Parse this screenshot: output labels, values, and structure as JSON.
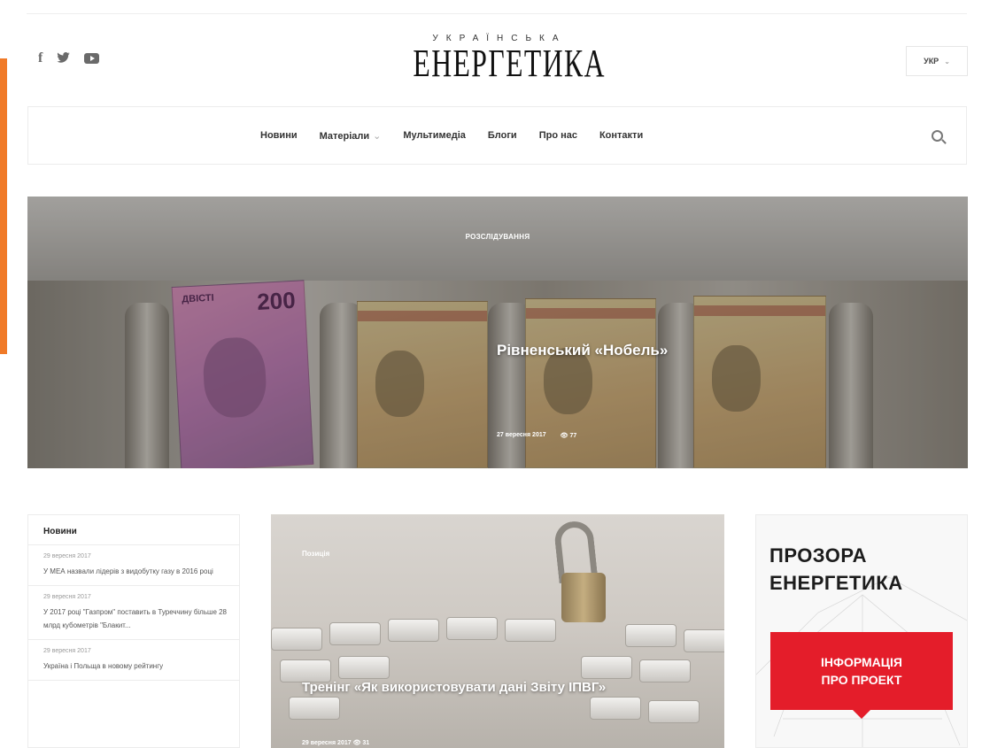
{
  "social": {
    "facebook": "f",
    "icons": [
      "facebook-icon",
      "twitter-icon",
      "youtube-icon"
    ]
  },
  "logo": {
    "small": "УКРАЇНСЬКА",
    "main": "ЕНЕРГЕТИКА"
  },
  "language": {
    "selected": "УКР",
    "chevron": "⌄"
  },
  "nav": {
    "items": [
      "Новини",
      "Матеріали",
      "Мультимедіа",
      "Блоги",
      "Про нас",
      "Контакти"
    ],
    "dropdown_marker": "⌄"
  },
  "hero": {
    "category": "РОЗСЛІДУВАННЯ",
    "title": "Рівненський «Нобель»",
    "date": "27 вересня 2017",
    "views": "👁 77",
    "banknote_label": "ДВІСТІ",
    "banknote_value": "200"
  },
  "news": {
    "title": "Новини",
    "items": [
      {
        "date": "29 вересня 2017",
        "text": "У МЕА назвали лідерів з видобутку газу в 2016 році"
      },
      {
        "date": "29 вересня 2017",
        "text": "У 2017 році \"Газпром\" поставить в Туреччину більше 28 млрд кубометрів \"Блакит..."
      },
      {
        "date": "29 вересня 2017",
        "text": "Україна і Польща в новому рейтингу"
      }
    ]
  },
  "featured": {
    "category": "Позиція",
    "title": "Тренінг «Як використовувати дані Звіту ІПВГ»",
    "meta": "29 вересня 2017   👁 31"
  },
  "promo": {
    "line1": "ПРОЗОРА",
    "line2": "ЕНЕРГЕТИКА",
    "button_line1": "ІНФОРМАЦІЯ",
    "button_line2": "ПРО ПРОЕКТ",
    "accent": "#e41d2a"
  },
  "colors": {
    "side_accent": "#f07a28",
    "promo_red": "#e41d2a"
  }
}
